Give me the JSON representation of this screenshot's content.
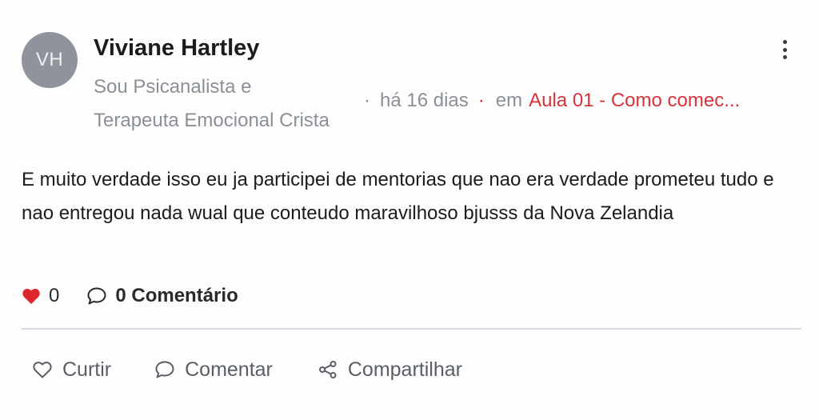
{
  "author": {
    "initials": "VH",
    "name": "Viviane Hartley",
    "bio_line1": "Sou Psicanalista e",
    "bio_line2": "Terapeuta Emocional Crista"
  },
  "meta": {
    "separator": "·",
    "time": "há 16 dias",
    "in_label": "em",
    "course": "Aula 01 - Como comec..."
  },
  "post": {
    "text": "E muito verdade isso eu ja participei de mentorias que nao era verdade prometeu tudo e nao entregou nada wual que conteudo maravilhoso bjusss da Nova Zelandia"
  },
  "stats": {
    "likes": "0",
    "comments": "0 Comentário"
  },
  "actions": {
    "like": "Curtir",
    "comment": "Comentar",
    "share": "Compartilhar"
  },
  "colors": {
    "accent": "#d6343a",
    "heart": "#e0262d",
    "muted": "#8b9097",
    "avatar_bg": "#8f949c"
  },
  "icons": {
    "more": "more-vertical-icon",
    "heart": "heart-filled-icon",
    "comment": "comment-bubble-icon",
    "like": "heart-outline-icon",
    "share": "share-icon"
  }
}
